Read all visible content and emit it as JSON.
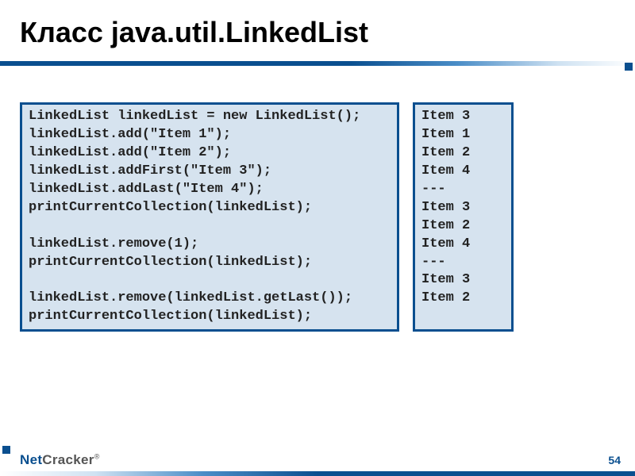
{
  "title": "Класс java.util.LinkedList",
  "code_left": "LinkedList linkedList = new LinkedList();\nlinkedList.add(\"Item 1\");\nlinkedList.add(\"Item 2\");\nlinkedList.addFirst(\"Item 3\");\nlinkedList.addLast(\"Item 4\");\nprintCurrentCollection(linkedList);\n\nlinkedList.remove(1);\nprintCurrentCollection(linkedList);\n\nlinkedList.remove(linkedList.getLast());\nprintCurrentCollection(linkedList);",
  "code_right": "Item 3\nItem 1\nItem 2\nItem 4\n---\nItem 3\nItem 2\nItem 4\n---\nItem 3\nItem 2",
  "logo_net": "Net",
  "logo_cracker": "Cracker",
  "logo_reg": "®",
  "page_number": "54"
}
